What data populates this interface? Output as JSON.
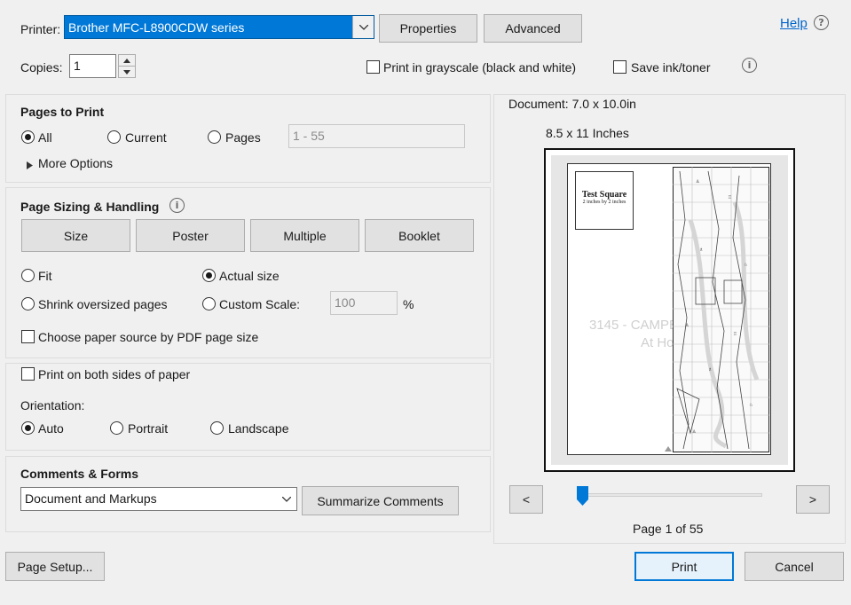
{
  "header": {
    "printer_label": "Printer:",
    "printer_value": "Brother MFC-L8900CDW series",
    "properties_label": "Properties",
    "advanced_label": "Advanced",
    "help_label": "Help",
    "copies_label": "Copies:",
    "copies_value": "1",
    "grayscale_label": "Print in grayscale (black and white)",
    "save_ink_label": "Save ink/toner"
  },
  "pages_to_print": {
    "title": "Pages to Print",
    "all_label": "All",
    "current_label": "Current",
    "pages_label": "Pages",
    "pages_value": "1 - 55",
    "more_options_label": "More Options",
    "selected": "All"
  },
  "sizing": {
    "title": "Page Sizing & Handling",
    "tabs": [
      "Size",
      "Poster",
      "Multiple",
      "Booklet"
    ],
    "fit_label": "Fit",
    "actual_size_label": "Actual size",
    "shrink_label": "Shrink oversized pages",
    "custom_scale_label": "Custom Scale:",
    "custom_scale_value": "100",
    "percent_label": "%",
    "paper_source_label": "Choose paper source by PDF page size",
    "selected": "Actual size"
  },
  "duplex": {
    "both_sides_label": "Print on both sides of paper",
    "orientation_label": "Orientation:",
    "auto_label": "Auto",
    "portrait_label": "Portrait",
    "landscape_label": "Landscape",
    "selected": "Auto"
  },
  "comments": {
    "title": "Comments & Forms",
    "select_value": "Document and Markups",
    "summarize_label": "Summarize Comments"
  },
  "preview": {
    "document_size": "Document: 7.0 x 10.0in",
    "paper_size": "8.5 x 11 Inches",
    "test_square_title": "Test Square",
    "test_square_sub": "2 inches by 2 inches",
    "watermark_line1": "3145 - CAMPBE",
    "watermark_line2": "At Ho",
    "prev_label": "<",
    "next_label": ">",
    "page_indicator": "Page 1 of 55",
    "slider_position": 0
  },
  "footer": {
    "page_setup_label": "Page Setup...",
    "print_label": "Print",
    "cancel_label": "Cancel"
  },
  "colors": {
    "accent": "#0078d7",
    "help_link": "#0066cc"
  }
}
